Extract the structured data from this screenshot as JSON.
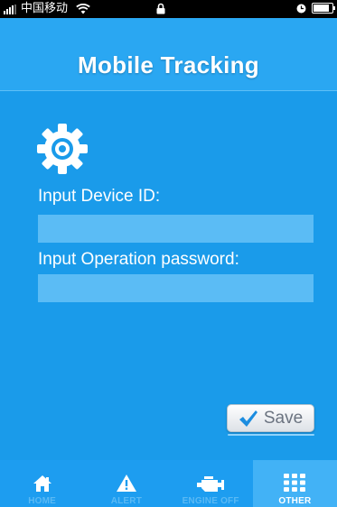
{
  "status_bar": {
    "carrier": "中国移动"
  },
  "header": {
    "title": "Mobile Tracking"
  },
  "form": {
    "device_id_label": "Input Device ID:",
    "device_id_value": "",
    "password_label": "Input Operation password:",
    "password_value": ""
  },
  "save_button": {
    "label": "Save"
  },
  "tabs": [
    {
      "label": "HOME",
      "icon": "home-icon",
      "active": false
    },
    {
      "label": "ALERT",
      "icon": "warning-icon",
      "active": false
    },
    {
      "label": "ENGINE OFF",
      "icon": "engine-icon",
      "active": false
    },
    {
      "label": "OTHER",
      "icon": "grid-icon",
      "active": true
    }
  ],
  "colors": {
    "background": "#1a9bea",
    "header": "#2aa7f2",
    "input": "#5bbcf5",
    "tab_active": "#42b2f6",
    "tab_label_inactive": "#5ab9f4"
  }
}
